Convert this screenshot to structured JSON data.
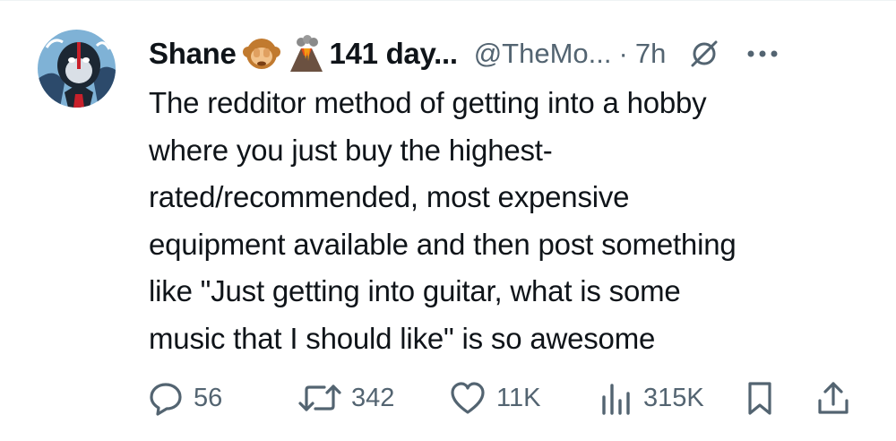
{
  "author": {
    "display_name": "Shane",
    "emoji_1": "monkey-emoji",
    "emoji_2": "volcano-emoji",
    "name_suffix": "141 day...",
    "handle": "@TheMo...",
    "separator": "·",
    "time": "7h"
  },
  "tweet": {
    "lines": [
      "The redditor method of getting into a hobby",
      "where you just buy the highest-",
      "rated/recommended, most expensive",
      "equipment available and then post something",
      "like \"Just getting into guitar, what is some",
      "music that I should like\" is so awesome"
    ]
  },
  "actions": {
    "replies": "56",
    "reposts": "342",
    "likes": "11K",
    "views": "315K"
  },
  "colors": {
    "text": "#0f1419",
    "secondary": "#536471",
    "background": "#ffffff"
  },
  "icons": [
    "grok-icon",
    "more-icon",
    "reply-icon",
    "repost-icon",
    "like-icon",
    "views-icon",
    "bookmark-icon",
    "share-icon"
  ]
}
